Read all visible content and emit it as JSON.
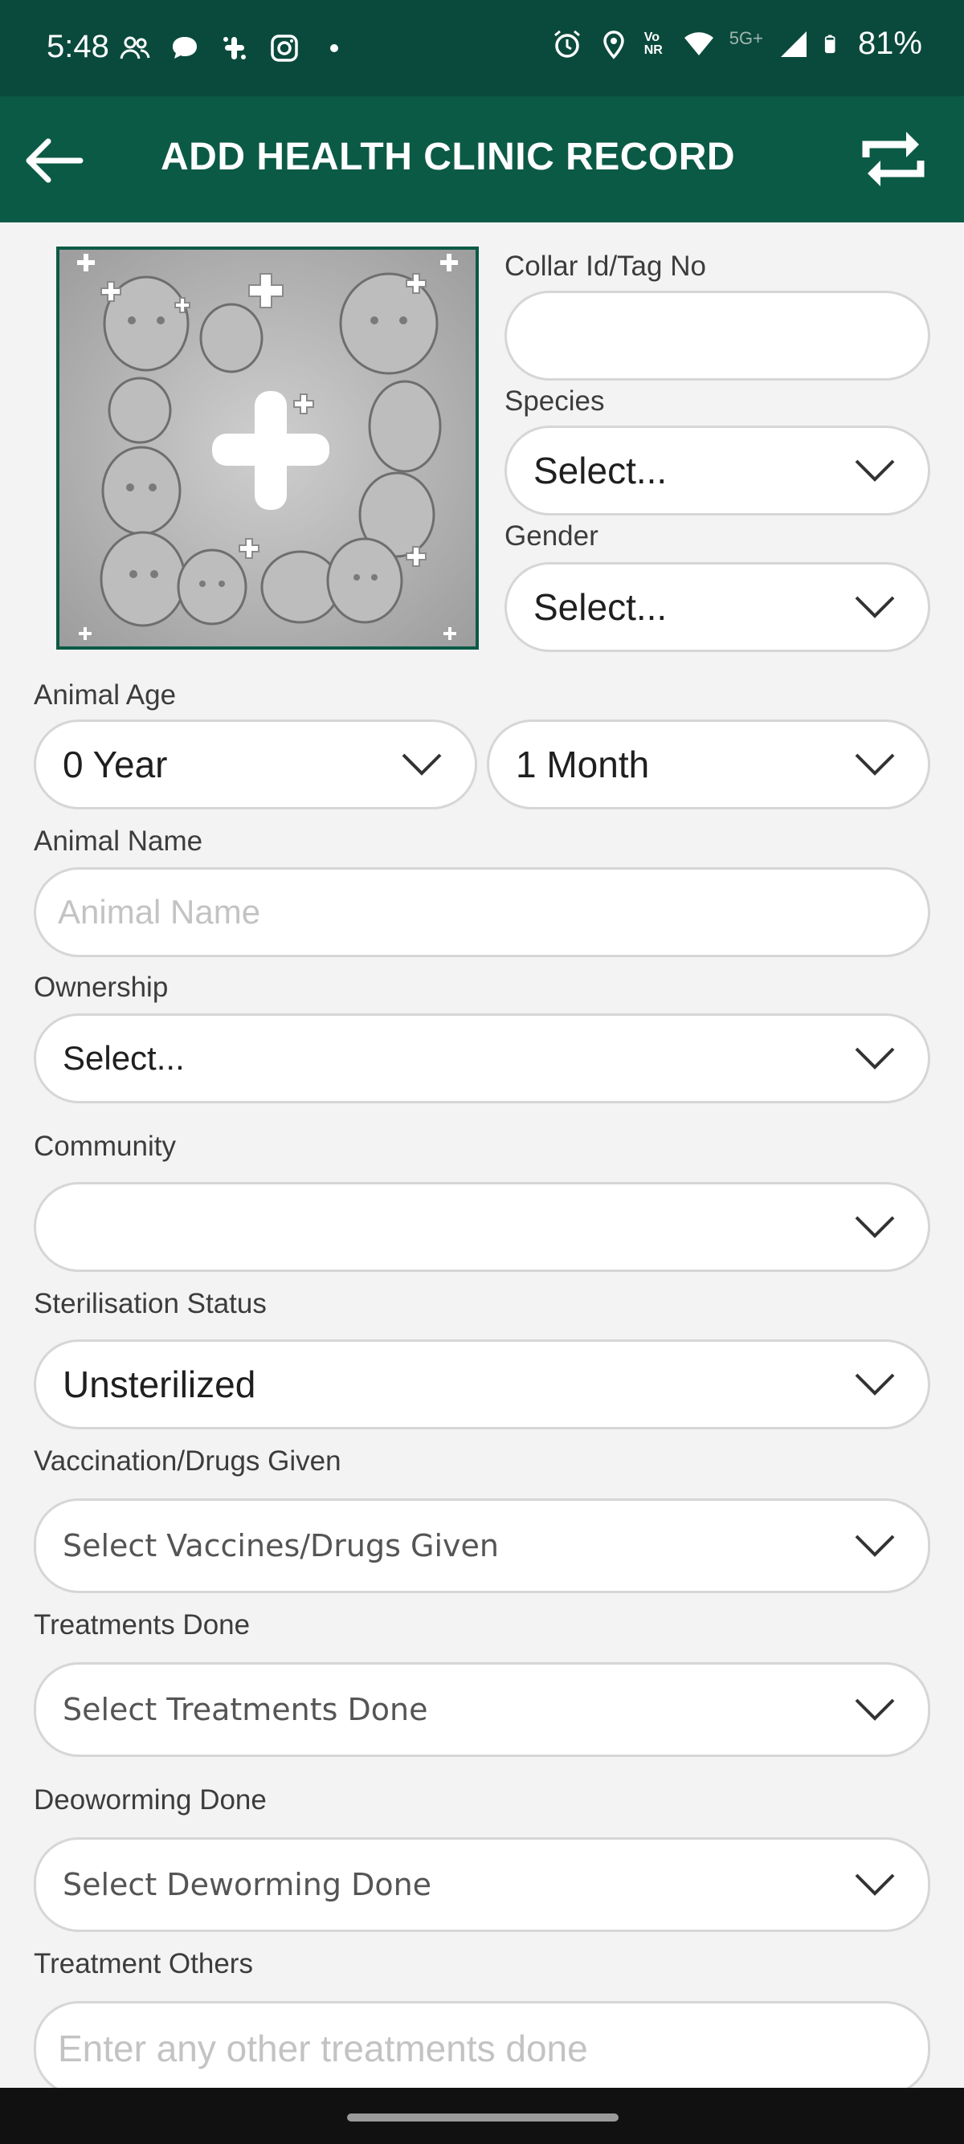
{
  "status_bar": {
    "time": "5:48",
    "battery": "81%",
    "network": "5G+",
    "volte": "Vo NR",
    "left_icons": [
      "people-icon",
      "chat-bubble-icon",
      "slack-icon",
      "instagram-icon",
      "dot-icon"
    ],
    "right_icons": [
      "alarm-icon",
      "location-icon",
      "wifi-icon",
      "signal-icon",
      "battery-icon"
    ]
  },
  "app_bar": {
    "title": "ADD HEALTH CLINIC RECORD",
    "back_icon": "arrow-left-icon",
    "sync_icon": "repeat-icon"
  },
  "form": {
    "collar": {
      "label": "Collar Id/Tag No",
      "value": ""
    },
    "species": {
      "label": "Species",
      "value": "Select..."
    },
    "gender": {
      "label": "Gender",
      "value": "Select..."
    },
    "age": {
      "label": "Animal Age",
      "years": "0 Year",
      "months": "1 Month"
    },
    "name": {
      "label": "Animal Name",
      "placeholder": "Animal Name"
    },
    "ownership": {
      "label": "Ownership",
      "value": "Select..."
    },
    "community": {
      "label": "Community",
      "value": ""
    },
    "sterilisation": {
      "label": "Sterilisation Status",
      "value": "Unsterilized"
    },
    "vaccination": {
      "label": "Vaccination/Drugs Given",
      "hint": "Select Vaccines/Drugs Given"
    },
    "treatments": {
      "label": "Treatments Done",
      "hint": "Select Treatments Done"
    },
    "deworming": {
      "label": "Deoworming Done",
      "hint": "Select Deworming Done"
    },
    "treatment_others": {
      "label": "Treatment Others",
      "placeholder": "Enter any other treatments done"
    }
  },
  "colors": {
    "status_bar": "#0a4a3c",
    "app_bar": "#0b5a45",
    "background": "#f3f3f3"
  }
}
